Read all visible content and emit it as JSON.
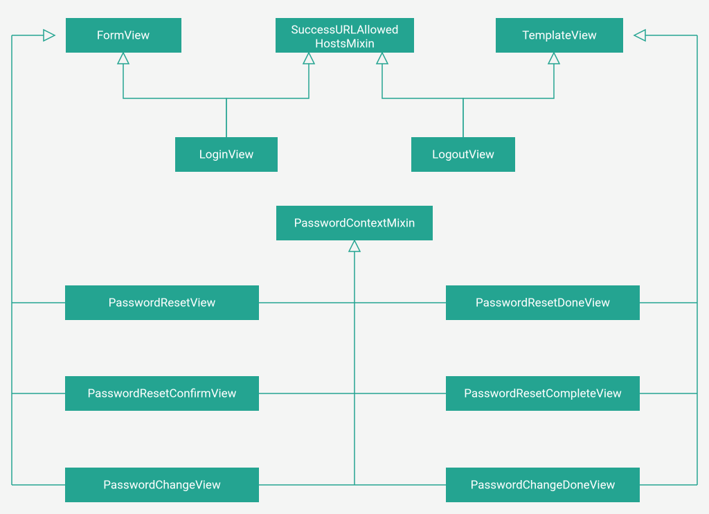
{
  "diagram": {
    "type": "uml-class-inheritance",
    "color": "#24a491",
    "nodes": {
      "FormView": "FormView",
      "SuccessURLAllowedHostsMixin": "SuccessURLAllowed\nHostsMixin",
      "TemplateView": "TemplateView",
      "LoginView": "LoginView",
      "LogoutView": "LogoutView",
      "PasswordContextMixin": "PasswordContextMixin",
      "PasswordResetView": "PasswordResetView",
      "PasswordResetDoneView": "PasswordResetDoneView",
      "PasswordResetConfirmView": "PasswordResetConfirmView",
      "PasswordResetCompleteView": "PasswordResetCompleteView",
      "PasswordChangeView": "PasswordChangeView",
      "PasswordChangeDoneView": "PasswordChangeDoneView"
    },
    "edges": [
      {
        "from": "LoginView",
        "to": "FormView"
      },
      {
        "from": "LoginView",
        "to": "SuccessURLAllowedHostsMixin"
      },
      {
        "from": "LogoutView",
        "to": "SuccessURLAllowedHostsMixin"
      },
      {
        "from": "LogoutView",
        "to": "TemplateView"
      },
      {
        "from": "PasswordResetView",
        "to": "PasswordContextMixin"
      },
      {
        "from": "PasswordResetConfirmView",
        "to": "PasswordContextMixin"
      },
      {
        "from": "PasswordChangeView",
        "to": "PasswordContextMixin"
      },
      {
        "from": "PasswordResetDoneView",
        "to": "PasswordContextMixin"
      },
      {
        "from": "PasswordResetCompleteView",
        "to": "PasswordContextMixin"
      },
      {
        "from": "PasswordChangeDoneView",
        "to": "PasswordContextMixin"
      },
      {
        "from": "PasswordResetView",
        "to": "FormView"
      },
      {
        "from": "PasswordResetConfirmView",
        "to": "FormView"
      },
      {
        "from": "PasswordChangeView",
        "to": "FormView"
      },
      {
        "from": "PasswordResetDoneView",
        "to": "TemplateView"
      },
      {
        "from": "PasswordResetCompleteView",
        "to": "TemplateView"
      },
      {
        "from": "PasswordChangeDoneView",
        "to": "TemplateView"
      }
    ]
  }
}
